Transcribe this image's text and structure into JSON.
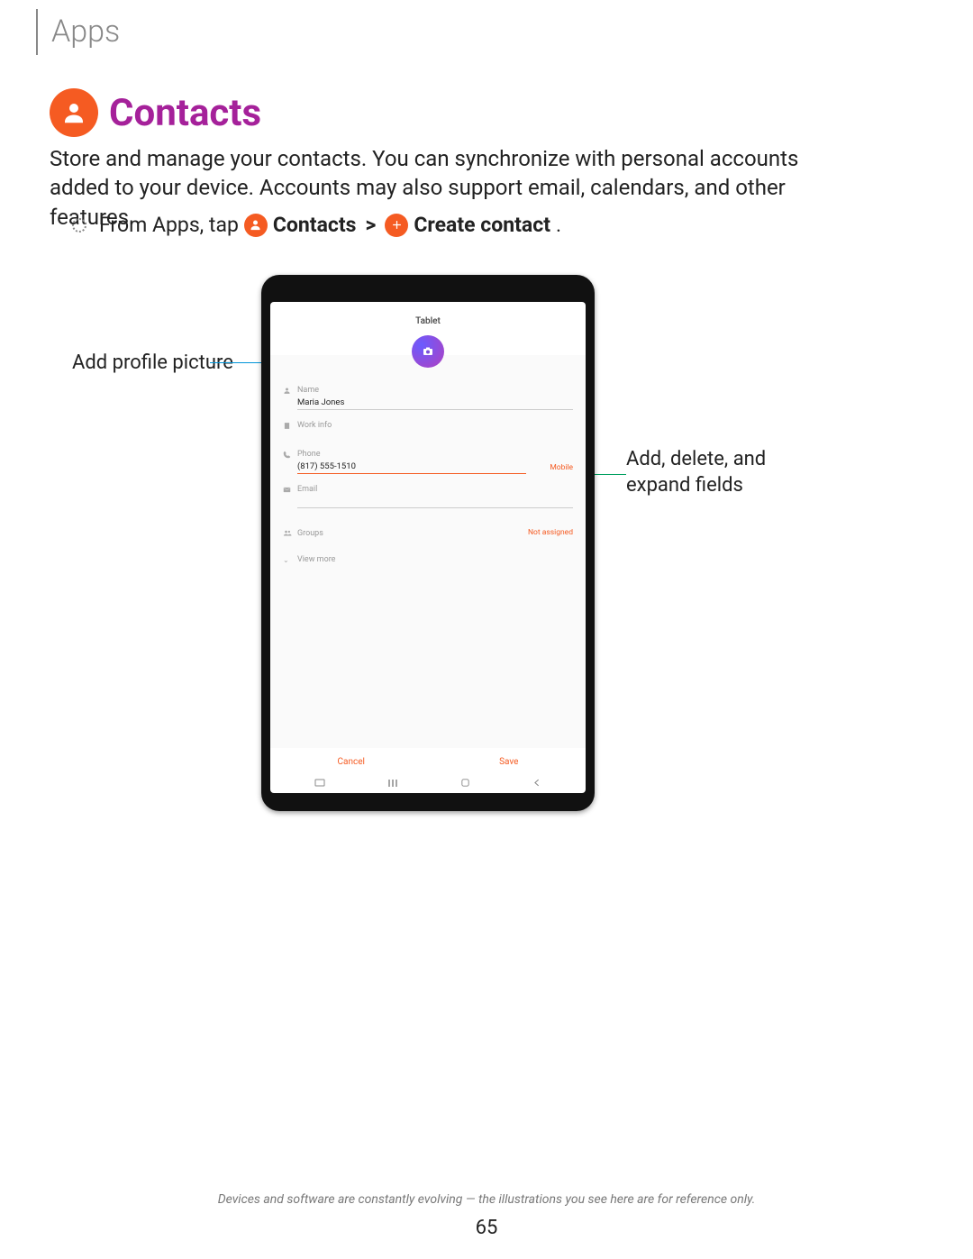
{
  "header": {
    "section": "Apps"
  },
  "title": "Contacts",
  "description": "Store and manage your contacts. You can synchronize with personal accounts added to your device. Accounts may also support email, calendars, and other features.",
  "instruction": {
    "prefix": "From Apps, tap",
    "contacts": "Contacts",
    "chevron": ">",
    "create": "Create contact",
    "suffix": "."
  },
  "callouts": {
    "left": "Add profile picture",
    "right_line1": "Add, delete, and",
    "right_line2": "expand fields"
  },
  "tablet": {
    "top": "Tablet",
    "fields": {
      "name_label": "Name",
      "name_value": "Maria Jones",
      "work_label": "Work info",
      "phone_label": "Phone",
      "phone_value": "(817) 555-1510",
      "phone_type": "Mobile",
      "email_label": "Email",
      "groups_label": "Groups",
      "groups_value": "Not assigned",
      "viewmore": "View more"
    },
    "actions": {
      "cancel": "Cancel",
      "save": "Save"
    }
  },
  "footer_note": "Devices and software are constantly evolving — the illustrations you see here are for reference only.",
  "page_number": "65"
}
